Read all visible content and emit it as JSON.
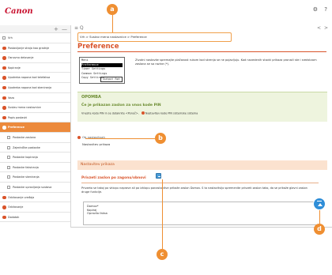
{
  "app": {
    "logo": "Canon",
    "settings_icon": "gear-icon",
    "help_icon": "?"
  },
  "sidebar": {
    "tools": {
      "collapse": "+",
      "expand": "—"
    },
    "items": [
      {
        "label": "Vrh",
        "icon": "square"
      },
      {
        "label": "Postavljanje stroja kao gradnje",
        "icon": "dot"
      },
      {
        "label": "Osnovno delovanje",
        "icon": "dot"
      },
      {
        "label": "Kopiranje",
        "icon": "dot"
      },
      {
        "label": "Upotreba napona kod telefaksa",
        "icon": "dot"
      },
      {
        "label": "Upotreba napona kod skeniranja",
        "icon": "dot"
      },
      {
        "label": "Veza",
        "icon": "dot"
      },
      {
        "label": "Sustav mena nastavnice",
        "icon": "dot"
      },
      {
        "label": "Popis postavki",
        "icon": "dot"
      },
      {
        "label": "Preference",
        "icon": "dot",
        "active": true
      },
      {
        "label": "Postavke zaslona",
        "icon": "square",
        "sub": true
      },
      {
        "label": "Zajedničke postavke",
        "icon": "square",
        "sub": true
      },
      {
        "label": "Postavke kopiranja",
        "icon": "square",
        "sub": true
      },
      {
        "label": "Postavke faksiranja",
        "icon": "square",
        "sub": true
      },
      {
        "label": "Postavke skeniranja",
        "icon": "square",
        "sub": true
      },
      {
        "label": "Postavke upravljanja sustava",
        "icon": "square",
        "sub": true
      },
      {
        "label": "Održavanje uređaja",
        "icon": "dot"
      },
      {
        "label": "Održavanje",
        "icon": "dot"
      },
      {
        "label": "Dodatak",
        "icon": "dot"
      }
    ]
  },
  "main": {
    "tools": {
      "menu": "≡ Q",
      "prev": "<",
      "next": ">"
    },
    "breadcrumb": "Vrh > Sustav mena nastavnice > Preference",
    "title": "Preference",
    "menu_shot": {
      "lines": [
        "Meni",
        "Preference",
        "Timer Settings",
        "Common Settings",
        "Copy Settings"
      ],
      "selected_index": 1,
      "ok": "Output Rpt"
    },
    "intro": "Zivotni nastavke spremajte plačanost rukom kod skrenja se ne pojavljuju. Kod navedenih stavki prikaza pronaći ste i sredstvom zaslona se sa razine (*).",
    "note": {
      "heading": "OPOMBA",
      "subheading": "Če je prikazan zaslon za vnos kode PIN",
      "body": "Vnesite kodo PIN in se dotaknite <Ponoč>.",
      "link": "Nastavitev kode PIN sistemske sistema"
    },
    "link_row": "Ob nastavitvah",
    "link_sub": "Nastavitev prikaza",
    "section": "Nastavitev prikaza",
    "subsection": "Privzeti zaslon po zagonu/obnovi",
    "description": "Privzeto se takoj po vklopu naprave ali po izklopu ponastavitve prikaže zaslon Domov. S to nastavitvijo spremenite privzeti zaslon tako, da se prikaže glavni zaslon druge funkcije.",
    "options": [
      "Domov*",
      "Kopiraj",
      "Opravilo faksa"
    ]
  },
  "callouts": {
    "a": "a",
    "b": "b",
    "c": "c",
    "d": "d"
  },
  "colors": {
    "accent": "#d9542b",
    "active": "#ec8a3c",
    "callout": "#ef8f32",
    "help": "#4a9bd6"
  }
}
